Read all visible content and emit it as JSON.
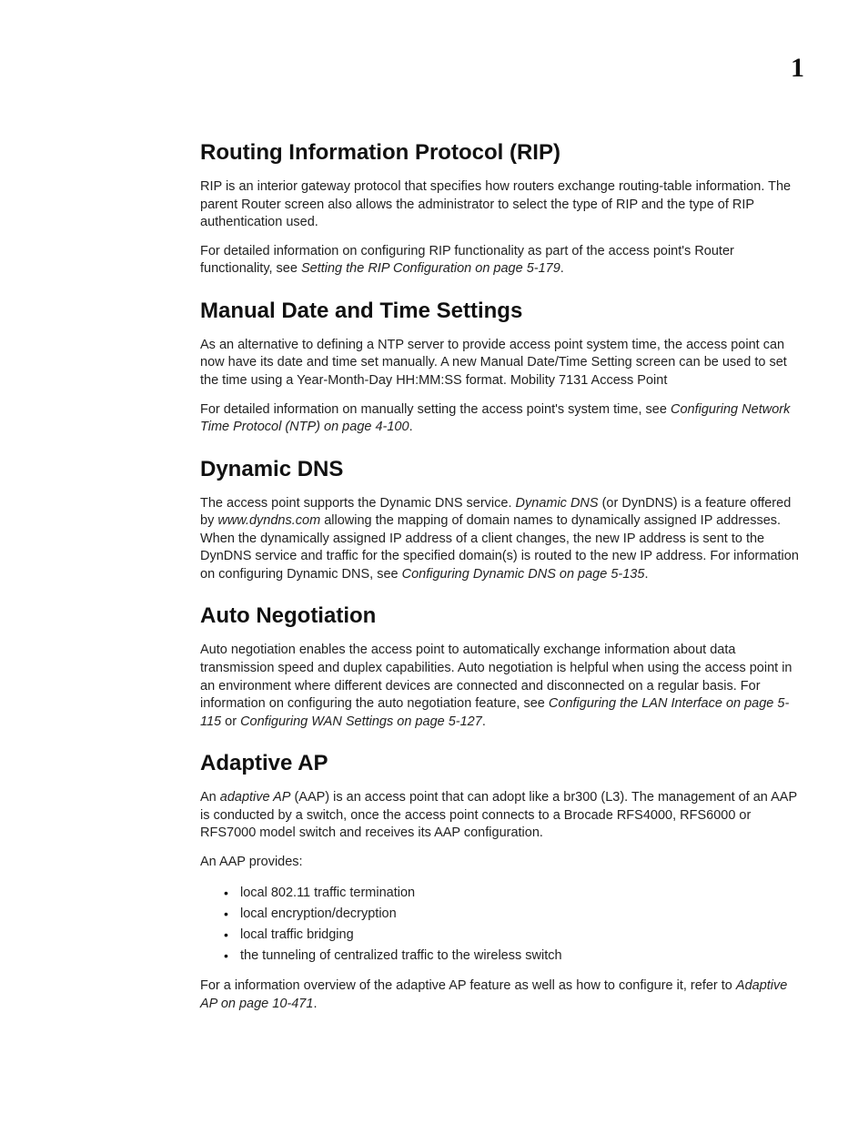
{
  "chapter_number": "1",
  "sections": [
    {
      "id": "rip",
      "heading": "Routing Information Protocol (RIP)",
      "paragraphs": [
        [
          {
            "t": "RIP is an interior gateway protocol that specifies how routers exchange routing-table information. The parent Router screen also allows the administrator to select the type of RIP and the type of RIP authentication used.",
            "i": false
          }
        ],
        [
          {
            "t": "For detailed information on configuring RIP functionality as part of the access point's Router functionality, see ",
            "i": false
          },
          {
            "t": "Setting the RIP Configuration on page 5-179",
            "i": true
          },
          {
            "t": ".",
            "i": false
          }
        ]
      ]
    },
    {
      "id": "datetime",
      "heading": "Manual Date and Time Settings",
      "paragraphs": [
        [
          {
            "t": "As an alternative to defining a NTP server to provide access point system time, the access point can now have its date and time set manually. A new Manual Date/Time Setting screen can be used to set the time using a Year-Month-Day HH:MM:SS format.  Mobility 7131 Access Point",
            "i": false
          }
        ],
        [
          {
            "t": "For detailed information on manually setting the access point's system time, see ",
            "i": false
          },
          {
            "t": "Configuring Network Time Protocol (NTP) on page 4-100",
            "i": true
          },
          {
            "t": ".",
            "i": false
          }
        ]
      ]
    },
    {
      "id": "ddns",
      "heading": "Dynamic DNS",
      "paragraphs": [
        [
          {
            "t": "The access point supports the Dynamic DNS service. ",
            "i": false
          },
          {
            "t": "Dynamic DNS",
            "i": true
          },
          {
            "t": " (or DynDNS) is a feature offered by ",
            "i": false
          },
          {
            "t": "www.dyndns.com",
            "i": true
          },
          {
            "t": " allowing the mapping of domain names to dynamically assigned IP addresses. When the dynamically assigned IP address of a client changes, the new IP address is sent to the DynDNS service and traffic for the specified domain(s) is routed to the new IP address. For information on configuring Dynamic DNS, see ",
            "i": false
          },
          {
            "t": "Configuring Dynamic DNS on page 5-135",
            "i": true
          },
          {
            "t": ".",
            "i": false
          }
        ]
      ]
    },
    {
      "id": "autoneg",
      "heading": "Auto Negotiation",
      "paragraphs": [
        [
          {
            "t": "Auto negotiation enables the access point to automatically exchange information about data transmission speed and duplex capabilities. Auto negotiation is helpful when using the access point in an environment where different devices are connected and disconnected on a regular basis. For information on configuring the auto negotiation feature, see ",
            "i": false
          },
          {
            "t": "Configuring the LAN Interface on page 5-115",
            "i": true
          },
          {
            "t": " or ",
            "i": false
          },
          {
            "t": "Configuring WAN Settings on page 5-127",
            "i": true
          },
          {
            "t": ".",
            "i": false
          }
        ]
      ]
    },
    {
      "id": "aap",
      "heading": "Adaptive AP",
      "paragraphs": [
        [
          {
            "t": "An ",
            "i": false
          },
          {
            "t": "adaptive AP",
            "i": true
          },
          {
            "t": " (AAP) is an access point that can adopt like a br300 (L3). The management of an AAP is conducted by a switch, once the access point connects to a Brocade RFS4000, RFS6000 or RFS7000 model switch and receives its AAP configuration.",
            "i": false
          }
        ],
        [
          {
            "t": "An AAP provides:",
            "i": false
          }
        ]
      ],
      "bullets": [
        "local 802.11 traffic termination",
        "local encryption/decryption",
        "local traffic bridging",
        "the tunneling of centralized traffic to the wireless switch"
      ],
      "paragraphs_after": [
        [
          {
            "t": "For a information overview of the adaptive AP feature as well as how to configure it, refer to ",
            "i": false
          },
          {
            "t": "Adaptive AP on page 10-471",
            "i": true
          },
          {
            "t": ".",
            "i": false
          }
        ]
      ]
    }
  ]
}
